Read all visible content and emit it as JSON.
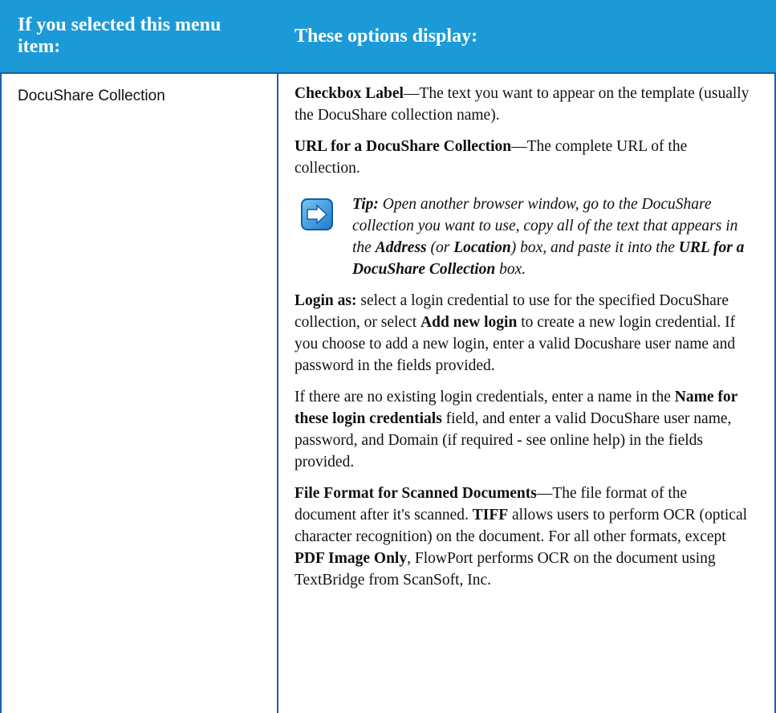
{
  "header": {
    "col1": "If you selected this menu item:",
    "col2": "These options display:"
  },
  "row": {
    "menu_item": "DocuShare Collection",
    "checkbox_label_term": "Checkbox Label",
    "checkbox_label_desc": "—The text you want to appear on the template (usually the DocuShare collection name).",
    "url_term": "URL for a DocuShare Collection",
    "url_desc": "—The complete URL of the collection.",
    "tip": {
      "label": "Tip:",
      "t1": " Open another browser window, go to the DocuShare collection you want to use, copy all of the text that appears in the ",
      "address": "Address",
      "t2": " (or ",
      "location": "Location",
      "t3": ") box, and paste it into the ",
      "url_box": "URL for a DocuShare Collection",
      "t4": " box."
    },
    "login": {
      "term": "Login as:",
      "t1": " select a login credential to use for the specified DocuShare collection, or select ",
      "add_new": "Add new login",
      "t2": " to create a new login credential. If you choose to add a new login, enter a valid Docushare user name and password in the fields provided."
    },
    "nologin": {
      "t1": "If there are no existing login credentials, enter a name in the ",
      "field": "Name for these login credentials",
      "t2": " field, and enter a valid DocuShare user name,  password, and Domain (if required - see online help) in the fields provided."
    },
    "format": {
      "term": "File Format for Scanned Documents",
      "t1": "—The file format of the document after it's scanned.  ",
      "tiff": "TIFF",
      "t2": " allows users to perform OCR (optical character recognition) on the document.  For all other formats, except ",
      "pdf": "PDF Image Only",
      "t3": ", FlowPort performs OCR on the document using TextBridge from ScanSoft, Inc."
    }
  },
  "colors": {
    "header_bg": "#1c9ad8",
    "rule": "#1a5fa8"
  },
  "icons": {
    "tip": "arrow-right-icon"
  }
}
